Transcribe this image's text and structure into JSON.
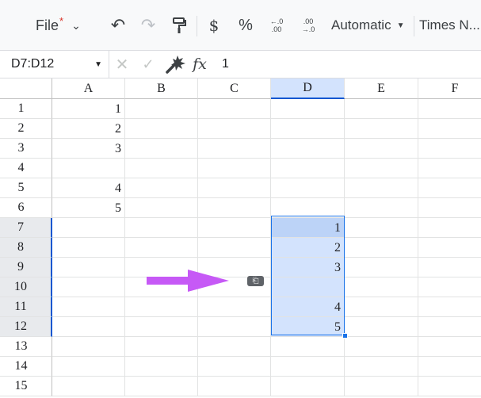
{
  "toolbar": {
    "file_label": "File",
    "file_modified_mark": "*",
    "file_chevron": "⌄",
    "undo_icon": "↶",
    "redo_icon": "↷",
    "currency_label": "$",
    "percent_label": "%",
    "decrease_decimal_top": "←.0",
    "decrease_decimal_bottom": ".00",
    "increase_decimal_top": ".00",
    "increase_decimal_bottom": "→.0",
    "number_format_label": "Automatic",
    "font_label": "Times N..."
  },
  "formula_bar": {
    "name_box_value": "D7:D12",
    "fx_label": "fx",
    "formula_value": "1"
  },
  "grid": {
    "columns": [
      "A",
      "B",
      "C",
      "D",
      "E",
      "F"
    ],
    "active_column": "D",
    "rows": [
      "1",
      "2",
      "3",
      "4",
      "5",
      "6",
      "7",
      "8",
      "9",
      "10",
      "11",
      "12",
      "13",
      "14",
      "15"
    ],
    "active_rows": [
      "7",
      "8",
      "9",
      "10",
      "11",
      "12"
    ],
    "column_a_values": [
      "1",
      "2",
      "3",
      "",
      "4",
      "5"
    ],
    "column_d_values": [
      "1",
      "2",
      "3",
      "",
      "4",
      "5"
    ],
    "paste_badge_label": "⎗"
  },
  "colors": {
    "selection_border": "#1a73e8",
    "selection_fill": "#d3e3fd",
    "arrow": "#c659f6"
  }
}
